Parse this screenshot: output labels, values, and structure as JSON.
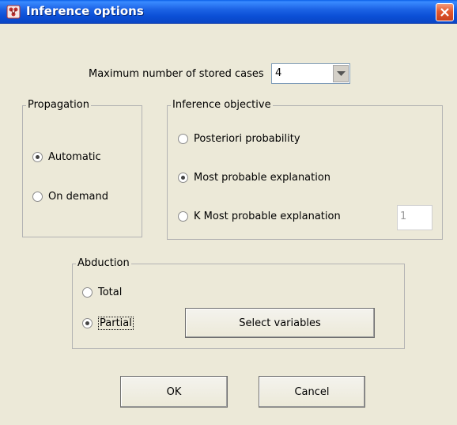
{
  "window": {
    "title": "Inference options",
    "close_icon": "close-icon"
  },
  "stored_cases": {
    "label": "Maximum number of stored cases",
    "value": "4"
  },
  "propagation": {
    "title": "Propagation",
    "options": [
      {
        "label": "Automatic",
        "checked": true
      },
      {
        "label": "On demand",
        "checked": false
      }
    ]
  },
  "inference_objective": {
    "title": "Inference objective",
    "options": [
      {
        "label": "Posteriori probability",
        "checked": false
      },
      {
        "label": "Most probable explanation",
        "checked": true
      },
      {
        "label": "K Most probable explanation",
        "checked": false
      }
    ],
    "k_value": "1"
  },
  "abduction": {
    "title": "Abduction",
    "options": [
      {
        "label": "Total",
        "checked": false
      },
      {
        "label": "Partial",
        "checked": true
      }
    ],
    "select_variables_label": "Select variables"
  },
  "buttons": {
    "ok": "OK",
    "cancel": "Cancel"
  }
}
